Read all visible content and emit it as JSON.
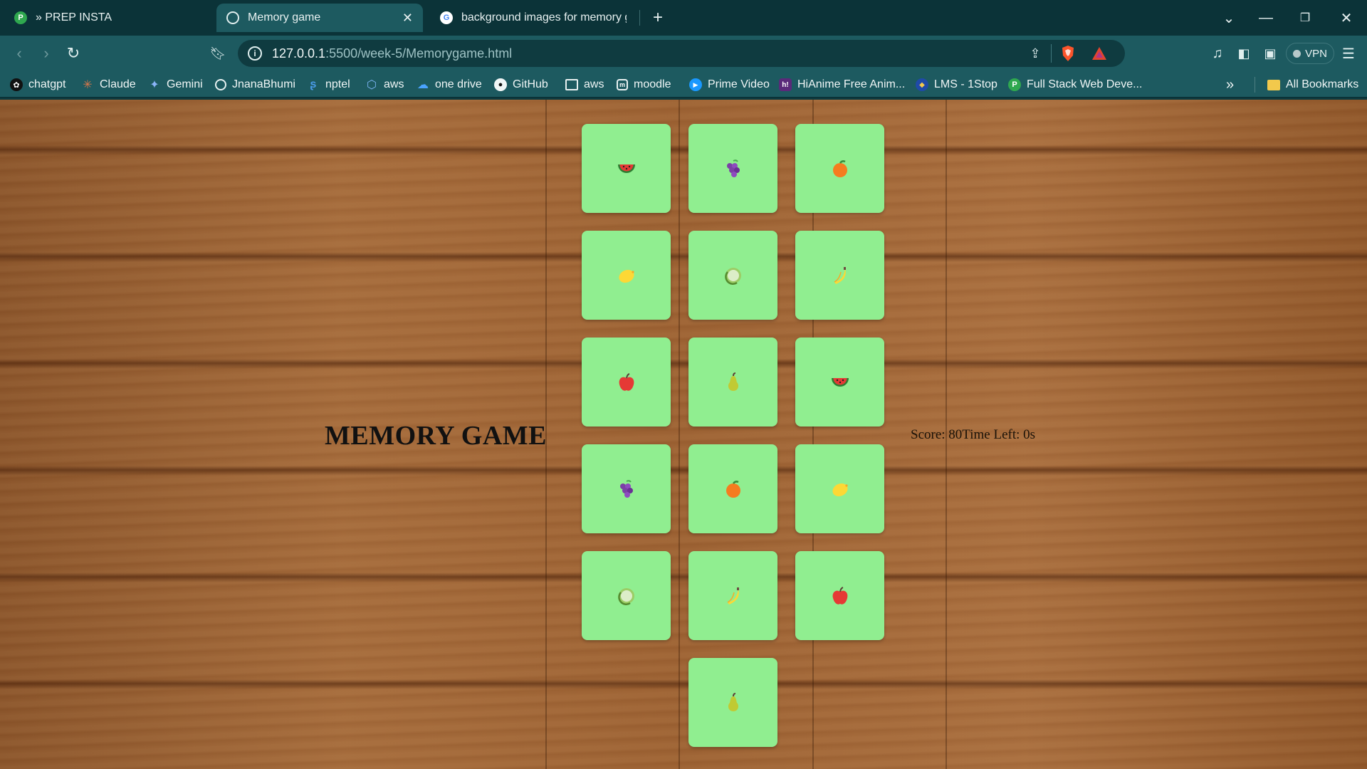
{
  "browser": {
    "tabs": [
      {
        "title": "» PREP INSTA",
        "active": false,
        "icon": "prepinsta-favicon"
      },
      {
        "title": "Memory game",
        "active": true,
        "icon": "globe-favicon"
      },
      {
        "title": "background images for memory game",
        "active": false,
        "icon": "google-favicon"
      }
    ],
    "url": {
      "host": "127.0.0.1",
      "path": ":5500/week-5/Memorygame.html"
    },
    "vpn_label": "VPN",
    "bookmarks": [
      {
        "label": "chatgpt",
        "icon": "chatgpt-icon"
      },
      {
        "label": "Claude",
        "icon": "claude-icon"
      },
      {
        "label": "Gemini",
        "icon": "gemini-icon"
      },
      {
        "label": "JnanaBhumi",
        "icon": "globe-icon"
      },
      {
        "label": "nptel",
        "icon": "nptel-icon"
      },
      {
        "label": "aws",
        "icon": "cube-icon"
      },
      {
        "label": "one drive",
        "icon": "cloud-icon"
      },
      {
        "label": "GitHub",
        "icon": "github-icon"
      },
      {
        "label": "aws",
        "icon": "image-icon"
      },
      {
        "label": "moodle",
        "icon": "moodle-icon"
      },
      {
        "label": "Prime Video",
        "icon": "prime-icon"
      },
      {
        "label": "HiAnime Free Anim...",
        "icon": "hianime-icon"
      },
      {
        "label": "LMS - 1Stop",
        "icon": "lms-icon"
      },
      {
        "label": "Full Stack Web Deve...",
        "icon": "prepinsta-icon"
      }
    ],
    "all_bookmarks_label": "All Bookmarks"
  },
  "page": {
    "title": "MEMORY GAME",
    "status_text": "Score: 80Time Left: 0s",
    "card_color": "#90ee90",
    "cards": [
      {
        "fruit": "watermelon"
      },
      {
        "fruit": "grapes"
      },
      {
        "fruit": "orange"
      },
      {
        "fruit": "lemon"
      },
      {
        "fruit": "melon"
      },
      {
        "fruit": "banana"
      },
      {
        "fruit": "apple"
      },
      {
        "fruit": "pear"
      },
      {
        "fruit": "watermelon"
      },
      {
        "fruit": "grapes"
      },
      {
        "fruit": "orange"
      },
      {
        "fruit": "lemon"
      },
      {
        "fruit": "melon"
      },
      {
        "fruit": "banana"
      },
      {
        "fruit": "apple"
      },
      {
        "fruit": "pear"
      }
    ]
  }
}
